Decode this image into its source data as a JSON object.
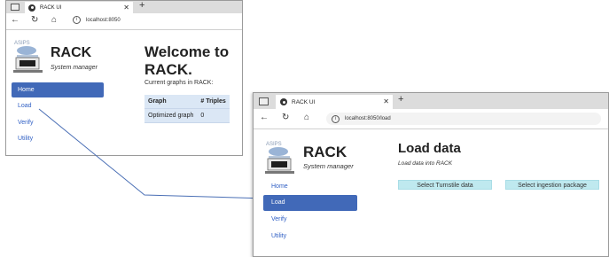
{
  "colors": {
    "nav_active": "#4169b8",
    "nav_link": "#2f5fc4",
    "action_button": "#bfe9ef",
    "table_bg": "#dbe7f5",
    "connector_line": "#4a6fb5"
  },
  "home_window": {
    "tab_title": "RACK UI",
    "new_tab": "+",
    "url": "localhost:8050",
    "app_name": "RACK",
    "app_subtitle": "System manager",
    "nav": {
      "home": "Home",
      "load": "Load",
      "verify": "Verify",
      "utility": "Utility"
    },
    "heading": "Welcome to RACK.",
    "graphs_label": "Current graphs in RACK:",
    "table": {
      "headers": [
        "Graph",
        "# Triples"
      ],
      "rows": [
        [
          "Optimized graph",
          "0"
        ]
      ]
    }
  },
  "load_window": {
    "tab_title": "RACK UI",
    "new_tab": "+",
    "url": "localhost:8050/load",
    "app_name": "RACK",
    "app_subtitle": "System manager",
    "nav": {
      "home": "Home",
      "load": "Load",
      "verify": "Verify",
      "utility": "Utility"
    },
    "heading": "Load data",
    "subtitle": "Load data into RACK",
    "buttons": {
      "turnstile": "Select Turnstile data",
      "ingestion": "Select ingestion package"
    }
  }
}
